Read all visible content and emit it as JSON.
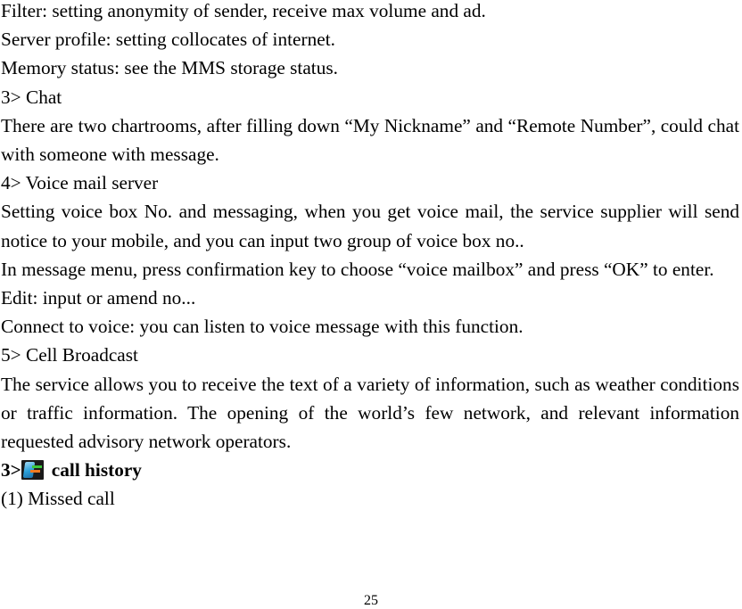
{
  "document": {
    "lines": {
      "filter": "Filter: setting anonymity of sender, receive max volume and ad.",
      "server_profile": "Server profile: setting collocates of internet.",
      "memory_status": "Memory status: see the MMS storage status.",
      "chat_heading": "3> Chat",
      "chat_paragraph": "There are two chartrooms, after filling down “My Nickname” and “Remote Number”, could chat with someone with message.",
      "voicemail_heading": "4> Voice mail server",
      "voicemail_paragraph_1": "Setting voice box No. and messaging, when you get voice mail, the service supplier will send notice to your mobile, and you can input two group of voice box no..",
      "voicemail_paragraph_2": "In message menu, press confirmation key to choose “voice mailbox” and press “OK” to enter.",
      "edit": "Edit: input or amend no...",
      "connect_to_voice": "Connect to voice: you can listen to voice message with this function.",
      "cell_broadcast_heading": "5> Cell Broadcast",
      "cell_broadcast_paragraph": "The service allows you to receive the text of a variety of information, such as weather conditions or traffic information. The opening of the world’s few network, and relevant information requested advisory network operators."
    },
    "section_heading": {
      "prefix": "3>",
      "icon": "call-history-icon",
      "title": "call history"
    },
    "missed_call": "(1) Missed call",
    "page_number": "25"
  }
}
